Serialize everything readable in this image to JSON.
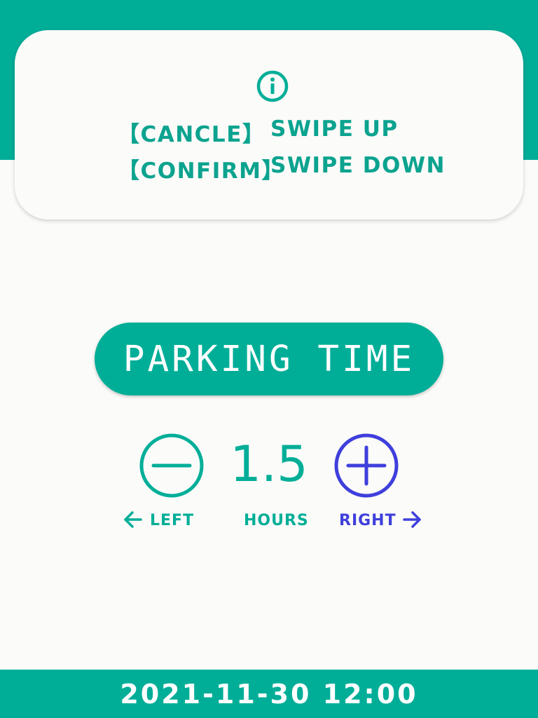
{
  "colors": {
    "primary": "#00ae98",
    "text_teal": "#0ba38f",
    "accent_blue": "#3f3fdc",
    "background": "#fbfbf9",
    "white": "#ffffff"
  },
  "info_card": {
    "icon": "info-icon",
    "hints": [
      {
        "key": "【CANCLE】",
        "action": "SWIPE UP"
      },
      {
        "key": "【CONFIRM】",
        "action": "SWIPE DOWN"
      }
    ]
  },
  "title": "PARKING TIME",
  "control": {
    "minus_icon": "minus-circle-icon",
    "plus_icon": "plus-circle-icon",
    "value": "1.5",
    "unit": "HOURS",
    "left_hint": "LEFT",
    "left_arrow_icon": "arrow-left-icon",
    "right_hint": "RIGHT",
    "right_arrow_icon": "arrow-right-icon"
  },
  "footer": {
    "datetime": "2021-11-30 12:00"
  }
}
